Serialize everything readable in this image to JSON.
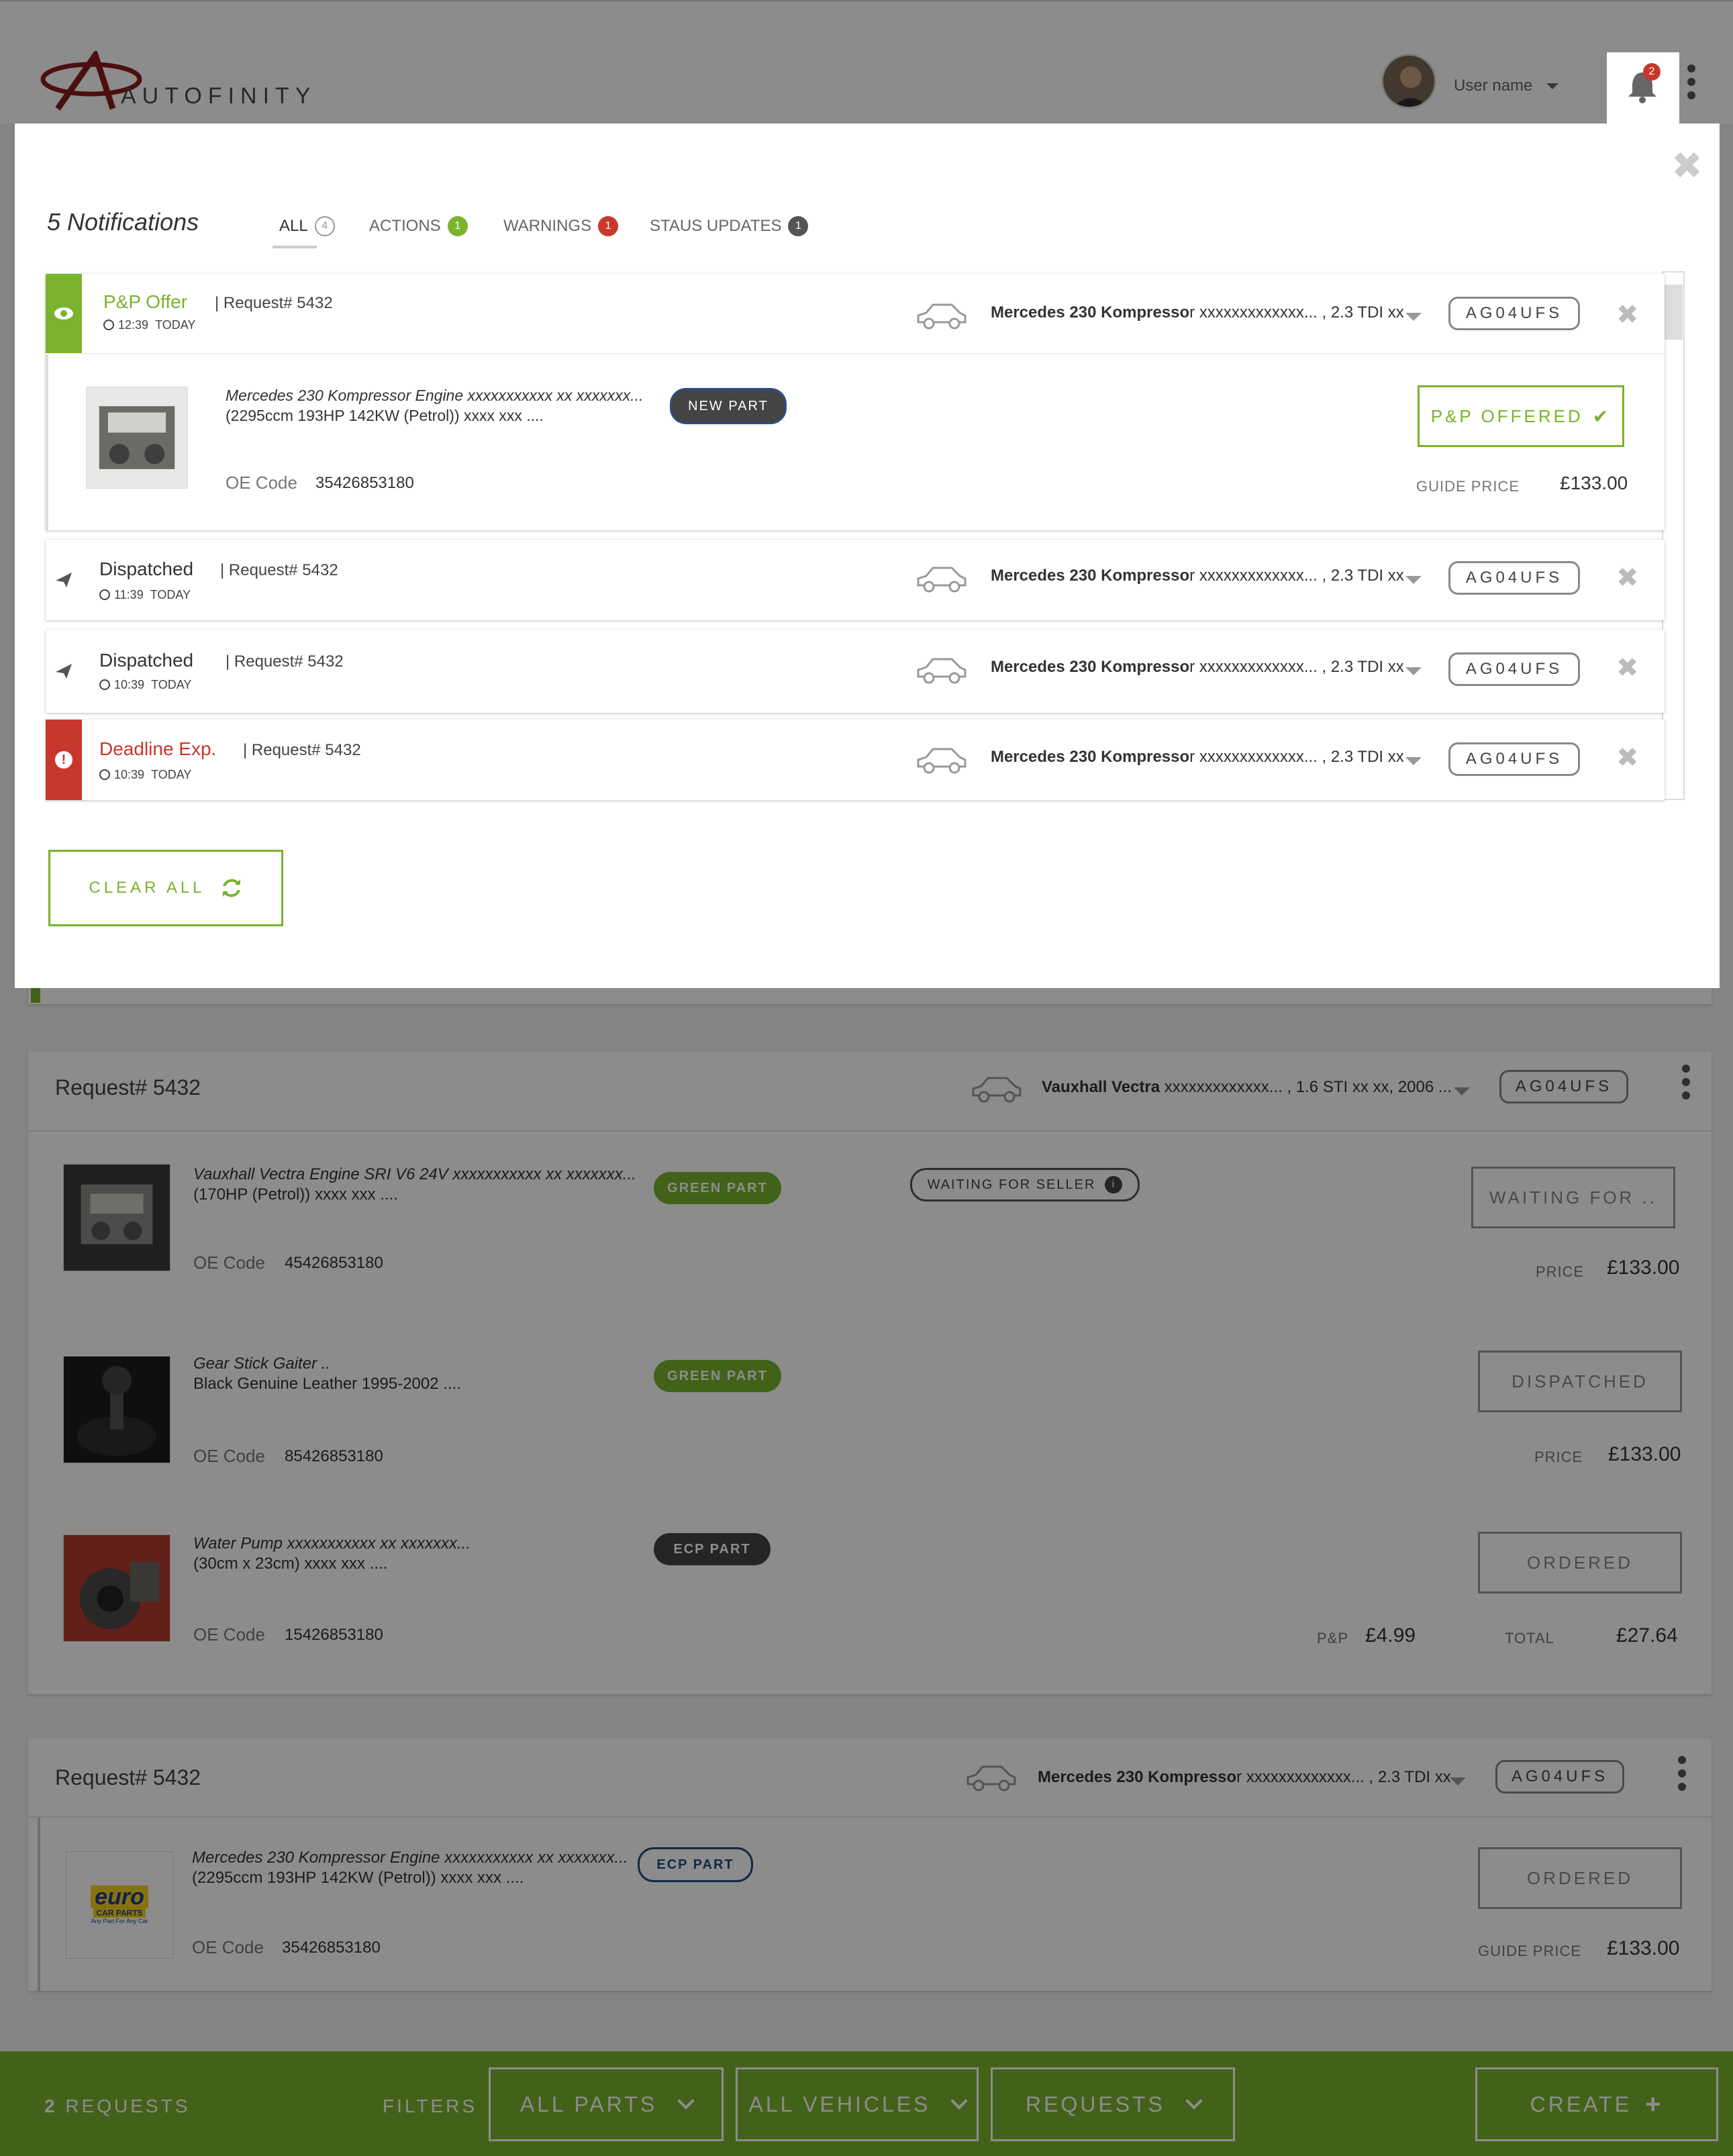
{
  "header": {
    "logo_text": "AUTOFINITY",
    "user_name": "User name",
    "bell_count": "2"
  },
  "modal": {
    "title": "5 Notifications",
    "tabs": [
      {
        "label": "ALL",
        "count": "4"
      },
      {
        "label": "ACTIONS",
        "count": "1"
      },
      {
        "label": "WARNINGS",
        "count": "1"
      },
      {
        "label": "STAUS UPDATES",
        "count": "1"
      }
    ],
    "notifications": [
      {
        "title": "P&P Offer",
        "request": "| Request# 5432",
        "time": "12:39",
        "day": "TODAY",
        "vehicle_bold": "Mercedes 230 Kompresso",
        "vehicle_rest": "r xxxxxxxxxxxxx... ,  2.3 TDI xx",
        "plate": "AG04UFS",
        "detail": {
          "name": "Mercedes 230 Kompressor Engine xxxxxxxxxxx xx xxxxxxx...",
          "desc": "(2295ccm 193HP 142KW (Petrol))  xxxx xxx ....",
          "tag": "NEW PART",
          "oe_label": "OE Code",
          "oe_value": "35426853180",
          "action": "P&P OFFERED",
          "price_label": "GUIDE PRICE",
          "price_value": "£133.00"
        }
      },
      {
        "title": "Dispatched",
        "request": "| Request# 5432",
        "time": "11:39",
        "day": "TODAY",
        "vehicle_bold": "Mercedes 230 Kompresso",
        "vehicle_rest": "r xxxxxxxxxxxxx... ,  2.3 TDI xx",
        "plate": "AG04UFS"
      },
      {
        "title": "Dispatched",
        "request": "| Request# 5432",
        "time": "10:39",
        "day": "TODAY",
        "vehicle_bold": "Mercedes 230 Kompresso",
        "vehicle_rest": "r xxxxxxxxxxxxx... ,  2.3 TDI xx",
        "plate": "AG04UFS"
      },
      {
        "title": "Deadline Exp.",
        "request": "| Request# 5432",
        "time": "10:39",
        "day": "TODAY",
        "vehicle_bold": "Mercedes 230 Kompresso",
        "vehicle_rest": "r xxxxxxxxxxxxx... ,  2.3 TDI xx",
        "plate": "AG04UFS"
      }
    ],
    "clear_all": "CLEAR ALL"
  },
  "requests": [
    {
      "title": "Request# 5432",
      "vehicle_bold": "Vauxhall Vectra",
      "vehicle_rest": " xxxxxxxxxxxxx... ,  1.6 STI xx xx, 2006 ...",
      "plate": "AG04UFS",
      "parts": [
        {
          "name": "Vauxhall Vectra Engine SRI V6 24V xxxxxxxxxxx xx xxxxxxx...",
          "desc": "(170HP (Petrol))  xxxx xxx ....",
          "tag": "GREEN PART",
          "status_tag": "WAITING FOR SELLER",
          "oe_label": "OE Code",
          "oe_value": "45426853180",
          "action": "WAITING FOR ..",
          "price_label": "PRICE",
          "price_value": "£133.00"
        },
        {
          "name": "Gear Stick Gaiter ..",
          "desc": " Black Genuine Leather 1995-2002 ....",
          "tag": "GREEN PART",
          "oe_label": "OE Code",
          "oe_value": "85426853180",
          "action": "DISPATCHED",
          "price_label": "PRICE",
          "price_value": "£133.00"
        },
        {
          "name": "Water Pump xxxxxxxxxxx xx xxxxxxx...",
          "desc": "(30cm x 23cm)  xxxx xxx ....",
          "tag": "ECP PART",
          "oe_label": "OE Code",
          "oe_value": "15426853180",
          "action": "ORDERED",
          "pp_label": "P&P",
          "pp_value": "£4.99",
          "price_label": "TOTAL",
          "price_value": "£27.64"
        }
      ]
    },
    {
      "title": "Request# 5432",
      "vehicle_bold": "Mercedes 230 Kompresso",
      "vehicle_rest": "r xxxxxxxxxxxxx... ,  2.3 TDI xx",
      "plate": "AG04UFS",
      "parts": [
        {
          "name": "Mercedes 230 Kompressor Engine xxxxxxxxxxx xx xxxxxxx...",
          "desc": "(2295ccm 193HP 142KW (Petrol))  xxxx xxx ....",
          "tag": "ECP PART",
          "oe_label": "OE Code",
          "oe_value": "35426853180",
          "action": "ORDERED",
          "price_label": "GUIDE PRICE",
          "price_value": "£133.00",
          "logo_text": "euro",
          "logo_sub": "CAR PARTS",
          "logo_tag": "Any Part For Any Car"
        }
      ]
    }
  ],
  "bottom_bar": {
    "count": "2",
    "count_label": "REQUESTS",
    "filters": "FILTERS",
    "all_parts": "ALL PARTS",
    "all_vehicles": "ALL VEHICLES",
    "requests": "REQUESTS",
    "create": "CREATE"
  },
  "colors": {
    "accent_green": "#7ab32e",
    "warning_red": "#c8372d",
    "dark_grey": "#444444",
    "navy": "#1f4a80"
  }
}
